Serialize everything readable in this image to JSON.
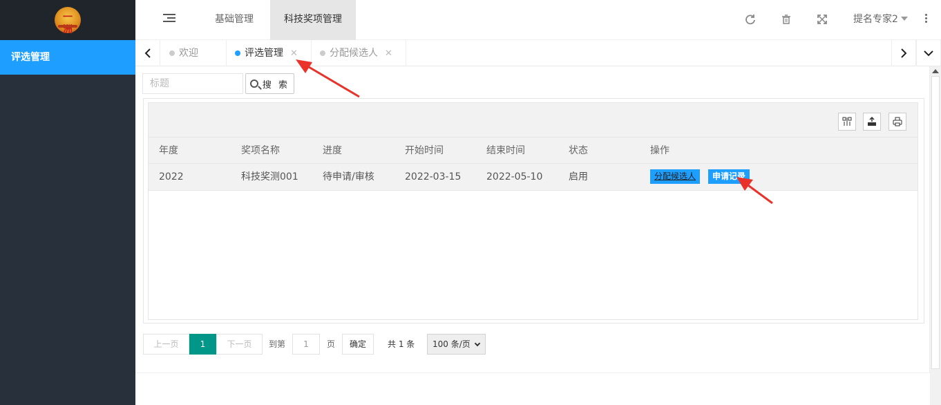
{
  "sidebar": {
    "logo_text": "一洲",
    "items": [
      {
        "label": "评选管理",
        "active": true
      }
    ]
  },
  "header": {
    "tabs": [
      {
        "label": "基础管理",
        "active": false
      },
      {
        "label": "科技奖项管理",
        "active": true
      }
    ],
    "icons": [
      "refresh-icon",
      "trash-icon",
      "fullscreen-icon"
    ],
    "user": "提名专家2"
  },
  "page_tabs": [
    {
      "label": "欢迎",
      "active": false,
      "closable": false
    },
    {
      "label": "评选管理",
      "active": true,
      "closable": true
    },
    {
      "label": "分配候选人",
      "active": false,
      "closable": true
    }
  ],
  "search": {
    "placeholder": "标题",
    "button_label": "搜 索"
  },
  "table": {
    "columns": [
      "年度",
      "奖项名称",
      "进度",
      "开始时间",
      "结束时间",
      "状态",
      "操作"
    ],
    "rows": [
      {
        "year": "2022",
        "name": "科技奖测001",
        "progress": "待申请/审核",
        "start": "2022-03-15",
        "end": "2022-05-10",
        "status": "启用",
        "actions": [
          "分配候选人",
          "申请记录"
        ]
      }
    ],
    "toolbar_icons": [
      "columns-icon",
      "export-icon",
      "print-icon"
    ]
  },
  "pagination": {
    "prev": "上一页",
    "current": "1",
    "next": "下一页",
    "goto_label": "到第",
    "goto_value": "1",
    "page_unit": "页",
    "confirm": "确定",
    "total": "共 1 条",
    "page_size": "100 条/页"
  },
  "colors": {
    "accent": "#1e9fff",
    "sidebar_bg": "#28303b",
    "pager_current": "#009688",
    "annotation": "#e8322a"
  }
}
